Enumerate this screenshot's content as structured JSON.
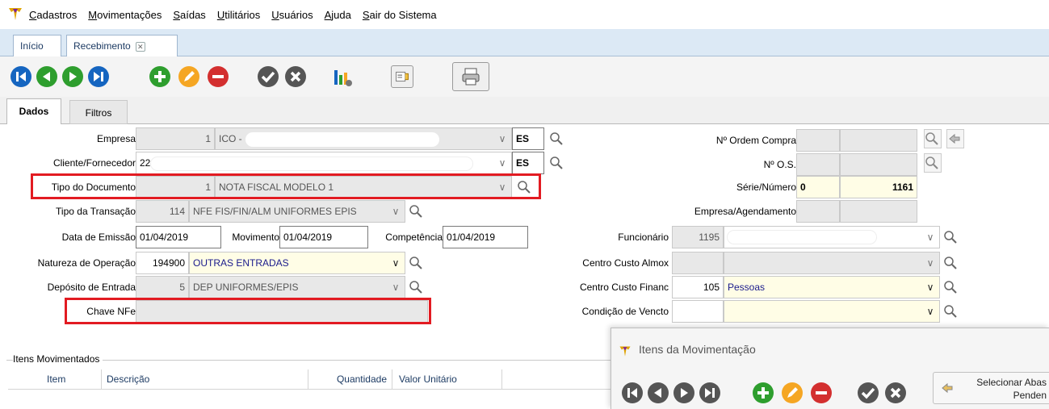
{
  "menu": {
    "items": [
      {
        "label": "Cadastros"
      },
      {
        "label": "Movimentações"
      },
      {
        "label": "Saídas"
      },
      {
        "label": "Utilitários"
      },
      {
        "label": "Usuários"
      },
      {
        "label": "Ajuda"
      },
      {
        "label": "Sair do Sistema"
      }
    ]
  },
  "tabs": [
    {
      "label": "Início"
    },
    {
      "label": "Recebimento"
    }
  ],
  "subtabs": [
    {
      "label": "Dados"
    },
    {
      "label": "Filtros"
    }
  ],
  "form": {
    "empresa": {
      "label": "Empresa",
      "code": "1",
      "name": "ICO -",
      "uf": "ES"
    },
    "cliente": {
      "label": "Cliente/Fornecedor",
      "code": "22",
      "uf": "ES"
    },
    "tipo_documento": {
      "label": "Tipo do Documento",
      "code": "1",
      "name": "NOTA FISCAL MODELO 1"
    },
    "tipo_transacao": {
      "label": "Tipo da Transação",
      "code": "114",
      "name": "NFE FIS/FIN/ALM UNIFORMES EPIS"
    },
    "data_emissao": {
      "label": "Data de Emissão",
      "value": "01/04/2019"
    },
    "movimento": {
      "label": "Movimento",
      "value": "01/04/2019"
    },
    "competencia": {
      "label": "Competência",
      "value": "01/04/2019"
    },
    "natureza": {
      "label": "Natureza de Operação",
      "code": "194900",
      "name": "OUTRAS ENTRADAS"
    },
    "deposito": {
      "label": "Depósito de Entrada",
      "code": "5",
      "name": "DEP UNIFORMES/EPIS"
    },
    "chave_nfe": {
      "label": "Chave NFe",
      "value": ""
    },
    "ordem_compra": {
      "label": "Nº Ordem Compra"
    },
    "os": {
      "label": "Nº O.S."
    },
    "serie_numero": {
      "label": "Série/Número",
      "serie": "0",
      "numero": "1161"
    },
    "empresa_agendamento": {
      "label": "Empresa/Agendamento"
    },
    "funcionario": {
      "label": "Funcionário",
      "code": "1195"
    },
    "cc_almox": {
      "label": "Centro Custo Almox"
    },
    "cc_financ": {
      "label": "Centro Custo Financ",
      "code": "105",
      "name": "Pessoas"
    },
    "condicao": {
      "label": "Condição de Vencto"
    }
  },
  "itens": {
    "title": "Itens Movimentados",
    "columns": [
      "Item",
      "Descrição",
      "Quantidade",
      "Valor Unitário"
    ]
  },
  "subwindow": {
    "title": "Itens da Movimentação",
    "select_button": {
      "line1": "Selecionar Abas",
      "line2": "Penden"
    }
  },
  "colors": {
    "nav_blue": "#1565c0",
    "add_green": "#2e9e2e",
    "edit_orange": "#f5a623",
    "delete_red": "#d32f2f",
    "gray_icon": "#555555",
    "highlight_red": "#e21b22",
    "tab_bar": "#dce9f5"
  }
}
